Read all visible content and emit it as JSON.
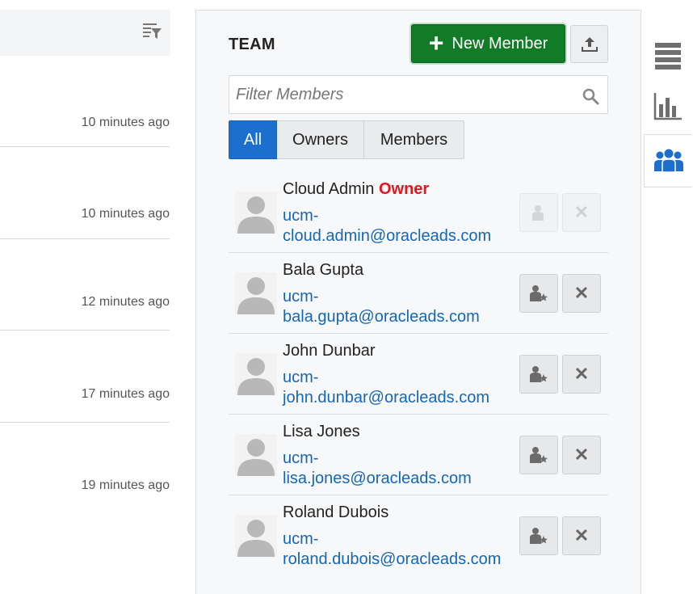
{
  "activity": {
    "times": [
      "10 minutes ago",
      "10 minutes ago",
      "12 minutes ago",
      "17 minutes ago",
      "19 minutes ago"
    ]
  },
  "team": {
    "title": "TEAM",
    "new_member_label": "New Member",
    "search_placeholder": "Filter Members",
    "filters": [
      "All",
      "Owners",
      "Members"
    ],
    "active_filter": "All",
    "owner_badge": "Owner",
    "members": [
      {
        "name": "Cloud Admin",
        "is_owner": true,
        "email_line1": "ucm-",
        "email_line2": "cloud.admin@oracleads.com"
      },
      {
        "name": "Bala Gupta",
        "is_owner": false,
        "email_line1": "ucm-",
        "email_line2": "bala.gupta@oracleads.com"
      },
      {
        "name": "John Dunbar",
        "is_owner": false,
        "email_line1": "ucm-",
        "email_line2": "john.dunbar@oracleads.com"
      },
      {
        "name": "Lisa Jones",
        "is_owner": false,
        "email_line1": "ucm-",
        "email_line2": "lisa.jones@oracleads.com"
      },
      {
        "name": "Roland Dubois",
        "is_owner": false,
        "email_line1": "ucm-",
        "email_line2": "roland.dubois@oracleads.com"
      }
    ]
  },
  "colors": {
    "new_button": "#127b28",
    "active_tab": "#1d6fcf",
    "owner_badge": "#e8141b",
    "email_link": "#1566b7"
  },
  "icons": [
    "filter-list-icon",
    "plus-icon",
    "upload-icon",
    "search-icon",
    "user-avatar-icon",
    "make-owner-icon",
    "remove-icon",
    "list-view-icon",
    "bar-chart-icon",
    "team-icon"
  ]
}
